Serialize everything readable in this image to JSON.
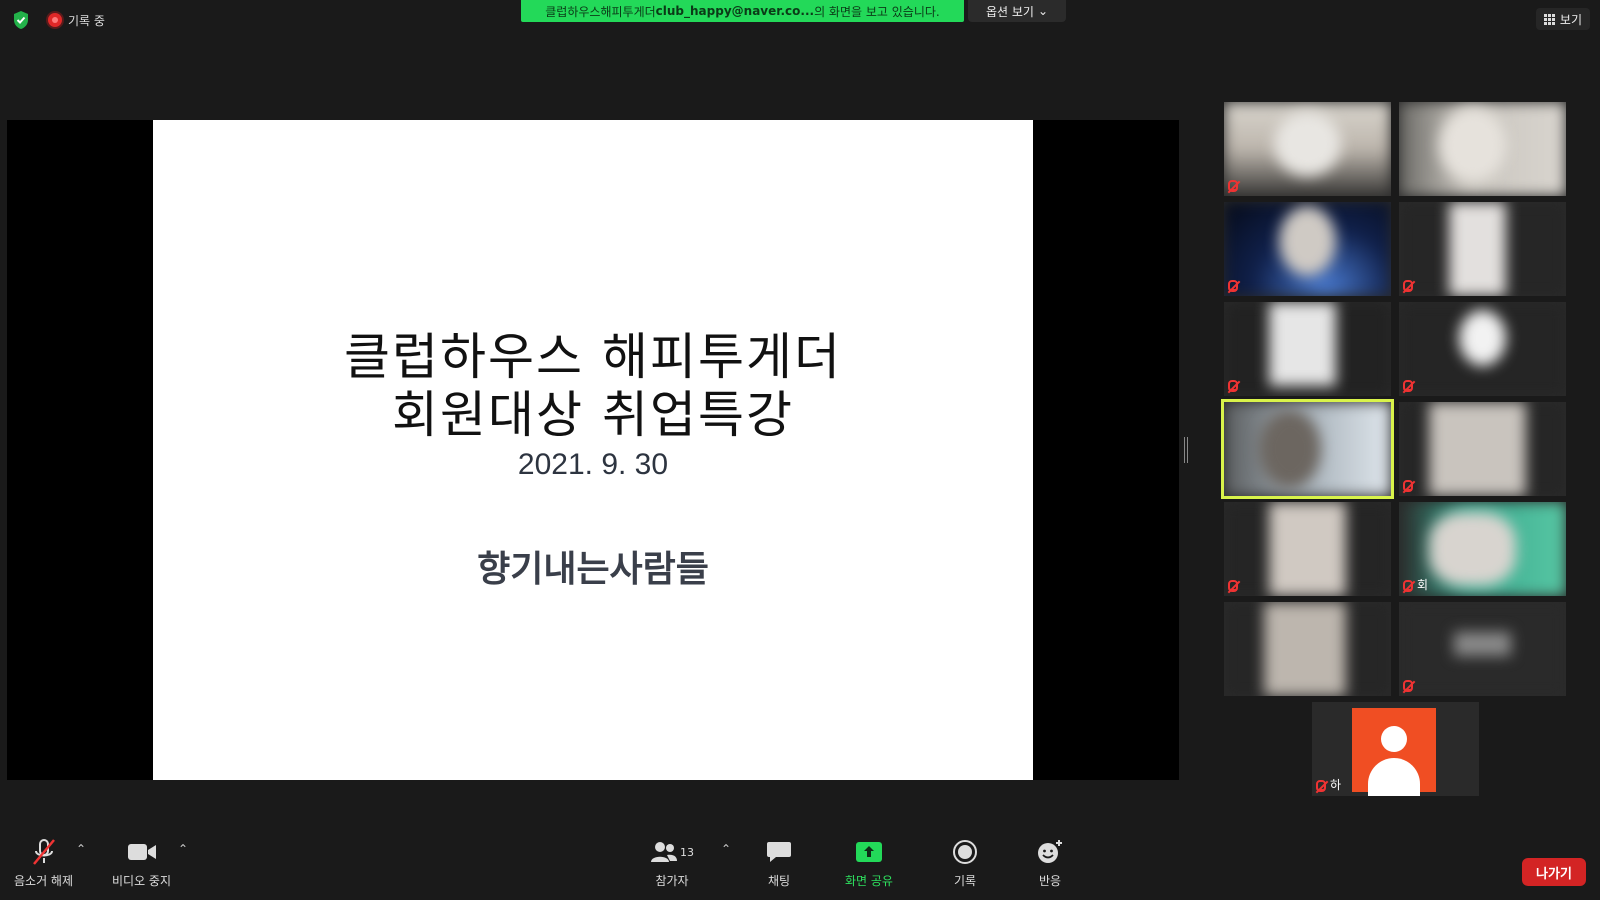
{
  "top": {
    "recording_label": "기록 중",
    "share_banner": {
      "prefix": "클럽하우스해피투게더 ",
      "email": "club_happy@naver.co...",
      "suffix": "의 화면을 보고 있습니다."
    },
    "view_options_label": "옵션 보기",
    "view_label": "보기"
  },
  "slide": {
    "title_line1": "클럽하우스 해피투게더",
    "title_line2": "회원대상 취업특강",
    "date": "2021. 9. 30",
    "organization": "향기내는사람들"
  },
  "gallery": {
    "partial_name": "회",
    "avatar_partial_name": "하"
  },
  "toolbar": {
    "unmute_label": "음소거 해제",
    "stop_video_label": "비디오 중지",
    "participants_label": "참가자",
    "participants_count": "13",
    "chat_label": "채팅",
    "share_label": "화면 공유",
    "record_label": "기록",
    "reactions_label": "반응",
    "leave_label": "나가기"
  },
  "colors": {
    "share_green": "#23d959",
    "active_speaker": "#d9f34a",
    "leave_red": "#d32424",
    "avatar_orange": "#f04e23"
  }
}
